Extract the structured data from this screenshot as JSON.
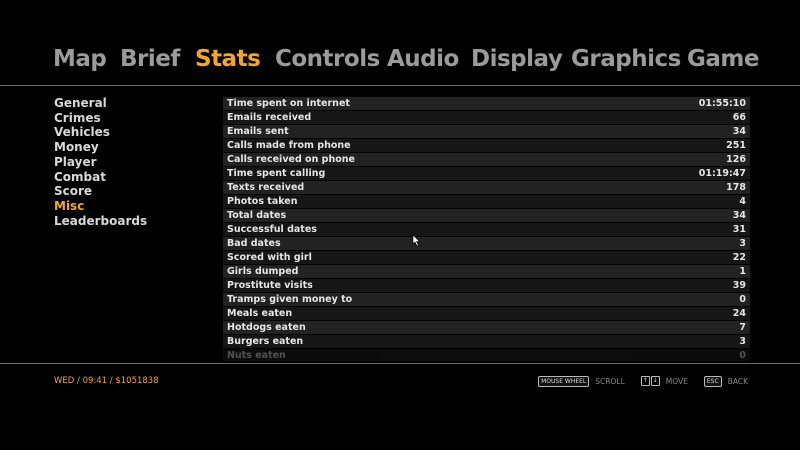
{
  "tabs": [
    {
      "label": "Map",
      "active": false
    },
    {
      "label": "Brief",
      "active": false
    },
    {
      "label": "Stats",
      "active": true
    },
    {
      "label": "Controls",
      "active": false
    },
    {
      "label": "Audio",
      "active": false
    },
    {
      "label": "Display",
      "active": false
    },
    {
      "label": "Graphics",
      "active": false
    },
    {
      "label": "Game",
      "active": false
    }
  ],
  "sidebar": {
    "items": [
      {
        "label": "General",
        "active": false
      },
      {
        "label": "Crimes",
        "active": false
      },
      {
        "label": "Vehicles",
        "active": false
      },
      {
        "label": "Money",
        "active": false
      },
      {
        "label": "Player",
        "active": false
      },
      {
        "label": "Combat",
        "active": false
      },
      {
        "label": "Score",
        "active": false
      },
      {
        "label": "Misc",
        "active": true
      },
      {
        "label": "Leaderboards",
        "active": false
      }
    ]
  },
  "stats": [
    {
      "label": "Time spent on internet",
      "value": "01:55:10"
    },
    {
      "label": "Emails received",
      "value": "66"
    },
    {
      "label": "Emails sent",
      "value": "34"
    },
    {
      "label": "Calls made from phone",
      "value": "251"
    },
    {
      "label": "Calls received on phone",
      "value": "126"
    },
    {
      "label": "Time spent calling",
      "value": "01:19:47"
    },
    {
      "label": "Texts received",
      "value": "178"
    },
    {
      "label": "Photos taken",
      "value": "4"
    },
    {
      "label": "Total dates",
      "value": "34"
    },
    {
      "label": "Successful dates",
      "value": "31"
    },
    {
      "label": "Bad dates",
      "value": "3"
    },
    {
      "label": "Scored with girl",
      "value": "22"
    },
    {
      "label": "Girls dumped",
      "value": "1"
    },
    {
      "label": "Prostitute visits",
      "value": "39"
    },
    {
      "label": "Tramps given money to",
      "value": "0"
    },
    {
      "label": "Meals eaten",
      "value": "24"
    },
    {
      "label": "Hotdogs eaten",
      "value": "7"
    },
    {
      "label": "Burgers eaten",
      "value": "3"
    },
    {
      "label": "Nuts eaten",
      "value": "0"
    }
  ],
  "status_bar": {
    "text": "WED / 09:41 / $1051838"
  },
  "hints": {
    "mouse_wheel_key": "MOUSE WHEEL",
    "scroll_label": "SCROLL",
    "up_key": "↑",
    "down_key": "↓",
    "move_label": "MOVE",
    "esc_key": "ESC",
    "back_label": "BACK"
  },
  "colors": {
    "accent": "#f5a623",
    "inactive_tab": "#9b9b9b",
    "background": "#000000"
  }
}
